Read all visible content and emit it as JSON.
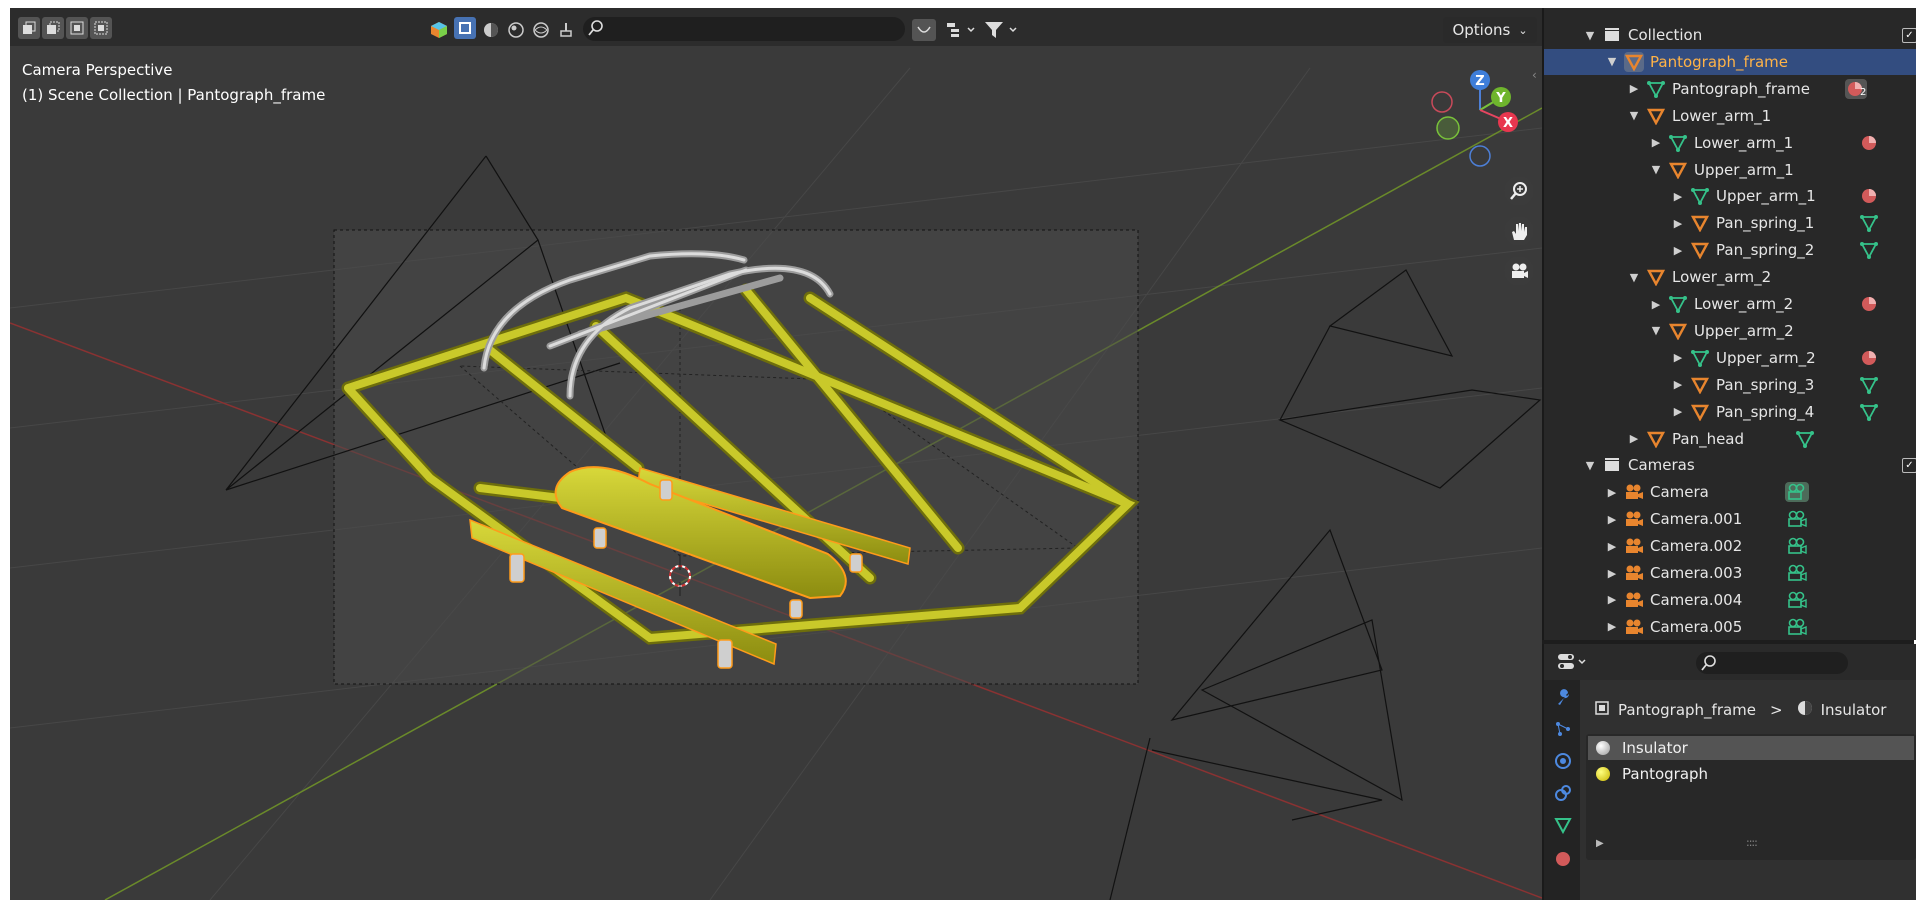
{
  "viewport": {
    "info_line1": "Camera Perspective",
    "info_line2": "(1) Scene Collection | Pantograph_frame",
    "options_label": "Options",
    "gizmo": {
      "z": "Z",
      "y": "Y",
      "x": "X"
    }
  },
  "outliner": {
    "rows": [
      {
        "label": "Collection",
        "icon": "collection-icon"
      },
      {
        "label": "Pantograph_frame",
        "icon": "object-icon",
        "selected": true
      },
      {
        "label": "Pantograph_frame",
        "icon": "mesh-data-icon",
        "badge": "2"
      },
      {
        "label": "Lower_arm_1",
        "icon": "object-icon"
      },
      {
        "label": "Lower_arm_1",
        "icon": "mesh-data-icon"
      },
      {
        "label": "Upper_arm_1",
        "icon": "object-icon"
      },
      {
        "label": "Upper_arm_1",
        "icon": "mesh-data-icon"
      },
      {
        "label": "Pan_spring_1",
        "icon": "object-icon"
      },
      {
        "label": "Pan_spring_2",
        "icon": "object-icon"
      },
      {
        "label": "Lower_arm_2",
        "icon": "object-icon"
      },
      {
        "label": "Lower_arm_2",
        "icon": "mesh-data-icon"
      },
      {
        "label": "Upper_arm_2",
        "icon": "object-icon"
      },
      {
        "label": "Upper_arm_2",
        "icon": "mesh-data-icon"
      },
      {
        "label": "Pan_spring_3",
        "icon": "object-icon"
      },
      {
        "label": "Pan_spring_4",
        "icon": "object-icon"
      },
      {
        "label": "Pan_head",
        "icon": "object-icon"
      },
      {
        "label": "Cameras",
        "icon": "collection-icon"
      },
      {
        "label": "Camera",
        "icon": "camera-object-icon"
      },
      {
        "label": "Camera.001",
        "icon": "camera-object-icon"
      },
      {
        "label": "Camera.002",
        "icon": "camera-object-icon"
      },
      {
        "label": "Camera.003",
        "icon": "camera-object-icon"
      },
      {
        "label": "Camera.004",
        "icon": "camera-object-icon"
      },
      {
        "label": "Camera.005",
        "icon": "camera-object-icon"
      }
    ]
  },
  "properties": {
    "breadcrumb_object": "Pantograph_frame",
    "breadcrumb_separator": ">",
    "breadcrumb_material": "Insulator",
    "material_slots": [
      {
        "label": "Insulator",
        "color": "#d9d9d9",
        "active": true
      },
      {
        "label": "Pantograph",
        "color": "#f0e000",
        "active": false
      }
    ]
  },
  "colors": {
    "selection": "#334d80",
    "active_object_text": "#ffb347",
    "object_icon": "#e8852e",
    "mesh_icon": "#35c28a",
    "material_icon": "#d25a5a",
    "model_yellow": "#b8b818"
  }
}
